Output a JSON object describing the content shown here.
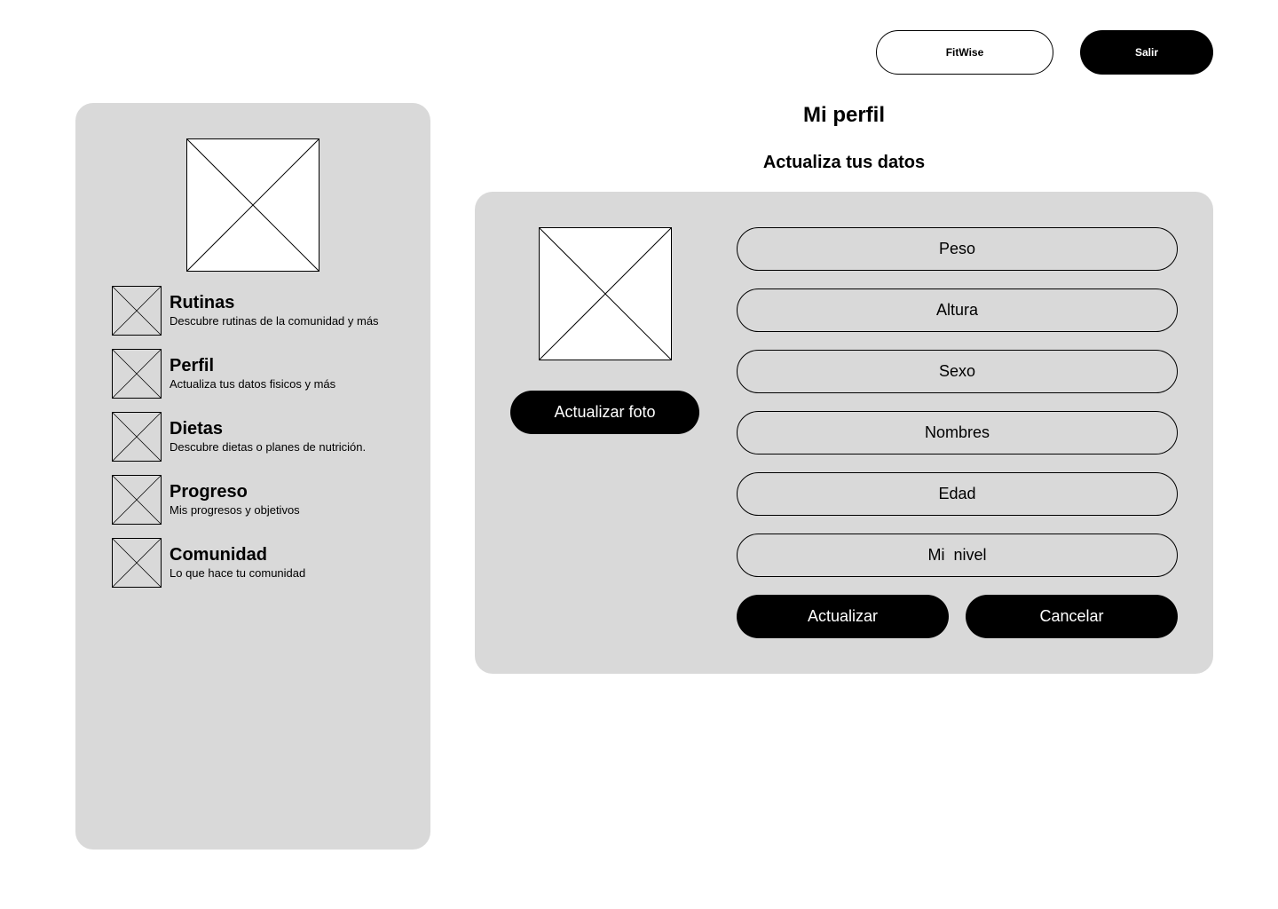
{
  "header": {
    "brand_button": "FitWise",
    "logout_button": "Salir"
  },
  "sidebar": {
    "avatar_icon": "image-placeholder-icon",
    "items": [
      {
        "title": "Rutinas",
        "desc": "Descubre rutinas de la comunidad y más",
        "icon": "image-placeholder-icon"
      },
      {
        "title": "Perfil",
        "desc": "Actualiza tus datos fisicos y más",
        "icon": "image-placeholder-icon"
      },
      {
        "title": "Dietas",
        "desc": "Descubre dietas o planes de nutrición.",
        "icon": "image-placeholder-icon"
      },
      {
        "title": "Progreso",
        "desc": "Mis progresos y objetivos",
        "icon": "image-placeholder-icon"
      },
      {
        "title": "Comunidad",
        "desc": "Lo que hace tu comunidad",
        "icon": "image-placeholder-icon"
      }
    ]
  },
  "main": {
    "title": "Mi perfil",
    "subtitle": "Actualiza tus datos",
    "photo_icon": "image-placeholder-icon",
    "update_photo_button": "Actualizar foto",
    "fields": [
      "Peso",
      "Altura",
      "Sexo",
      "Nombres",
      "Edad",
      "Mi  nivel"
    ],
    "update_button": "Actualizar",
    "cancel_button": "Cancelar"
  },
  "colors": {
    "panel_bg": "#d9d9d9",
    "button_dark": "#000000",
    "background": "#ffffff"
  }
}
